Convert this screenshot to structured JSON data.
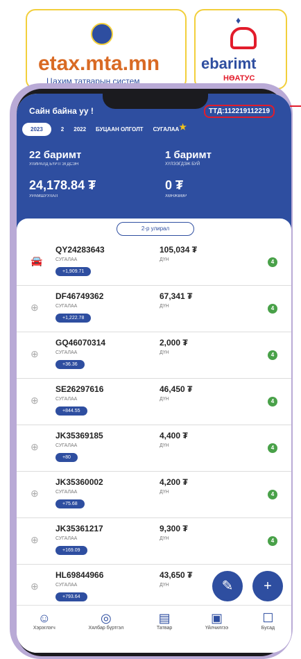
{
  "logos": {
    "etax": {
      "brand": "etax.mta.mn",
      "sub": "Цахим татварын систем"
    },
    "ebarimt": {
      "brand": "ebarimt",
      "sub": "НӨАТУС"
    }
  },
  "header": {
    "greeting": "Сайн байна уу !",
    "tin": "ТТД:112219112219",
    "tabs": [
      {
        "label": "2023"
      },
      {
        "label": "2"
      },
      {
        "label": "2022"
      },
      {
        "label": "БУЦААН ОЛГОЛТ"
      },
      {
        "label": "СУГАЛАА"
      }
    ],
    "stats": {
      "receipts": {
        "value": "22 баримт",
        "label": "УЛИРАЛД БҮРТГЭГДСЭН"
      },
      "pending": {
        "value": "1 баримт",
        "label": "ХҮЛЭЭГДЭЖ БУЙ"
      },
      "bonus": {
        "value": "24,178.84 ₮",
        "label": "УРАМШУУЛАЛ"
      },
      "discount": {
        "value": "0 ₮",
        "label": "ХӨНЖВӨР"
      }
    }
  },
  "section": {
    "quarter_button": "2-р улирал"
  },
  "list": [
    {
      "code": "QY24283643",
      "type": "СУГАЛАА",
      "badge": "+1,909.71",
      "amount": "105,034 ₮",
      "amount_label": "ДҮН",
      "count": "4"
    },
    {
      "code": "DF46749362",
      "type": "СУГАЛАА",
      "badge": "+1,222.78",
      "amount": "67,341 ₮",
      "amount_label": "ДҮН",
      "count": "4"
    },
    {
      "code": "GQ46070314",
      "type": "СУГАЛАА",
      "badge": "+36.36",
      "amount": "2,000 ₮",
      "amount_label": "ДҮН",
      "count": "4"
    },
    {
      "code": "SE26297616",
      "type": "СУГАЛАА",
      "badge": "+844.55",
      "amount": "46,450 ₮",
      "amount_label": "ДҮН",
      "count": "4"
    },
    {
      "code": "JK35369185",
      "type": "СУГАЛАА",
      "badge": "+80",
      "amount": "4,400 ₮",
      "amount_label": "ДҮН",
      "count": "4"
    },
    {
      "code": "JK35360002",
      "type": "СУГАЛАА",
      "badge": "+75.68",
      "amount": "4,200 ₮",
      "amount_label": "ДҮН",
      "count": "4"
    },
    {
      "code": "JK35361217",
      "type": "СУГАЛАА",
      "badge": "+169.09",
      "amount": "9,300 ₮",
      "amount_label": "ДҮН",
      "count": "4"
    },
    {
      "code": "HL69844966",
      "type": "СУГАЛАА",
      "badge": "+793.64",
      "amount": "43,650 ₮",
      "amount_label": "ДҮН",
      "count": ""
    }
  ],
  "bottom_nav": [
    {
      "label": "Хэрэглэгч"
    },
    {
      "label": "Хялбар бүртгэл"
    },
    {
      "label": "Татвар"
    },
    {
      "label": "Үйлчилгээ"
    },
    {
      "label": "Бусад"
    }
  ],
  "colors": {
    "primary": "#2e4ea0",
    "accent": "#e21c2b",
    "success": "#49a149"
  }
}
